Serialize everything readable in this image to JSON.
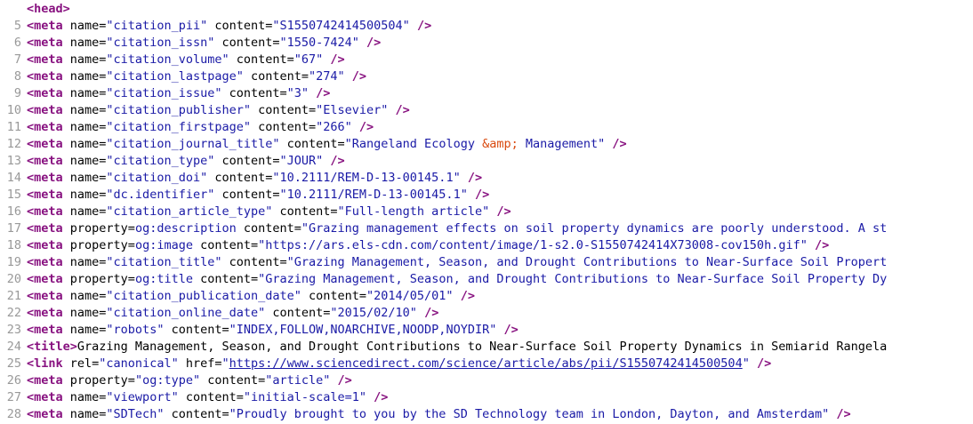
{
  "source_view": {
    "lines": [
      {
        "n": "",
        "tokens": [
          {
            "t": "tag",
            "s": "<head>"
          }
        ]
      },
      {
        "n": "5",
        "tokens": [
          {
            "t": "tag",
            "s": "<meta "
          },
          {
            "t": "attr",
            "s": "name="
          },
          {
            "t": "val",
            "s": "\"citation_pii\""
          },
          {
            "t": "attr",
            "s": " content="
          },
          {
            "t": "val",
            "s": "\"S1550742414500504\""
          },
          {
            "t": "tag",
            "s": " />"
          }
        ]
      },
      {
        "n": "6",
        "tokens": [
          {
            "t": "tag",
            "s": "<meta "
          },
          {
            "t": "attr",
            "s": "name="
          },
          {
            "t": "val",
            "s": "\"citation_issn\""
          },
          {
            "t": "attr",
            "s": " content="
          },
          {
            "t": "val",
            "s": "\"1550-7424\""
          },
          {
            "t": "tag",
            "s": " />"
          }
        ]
      },
      {
        "n": "7",
        "tokens": [
          {
            "t": "tag",
            "s": "<meta "
          },
          {
            "t": "attr",
            "s": "name="
          },
          {
            "t": "val",
            "s": "\"citation_volume\""
          },
          {
            "t": "attr",
            "s": " content="
          },
          {
            "t": "val",
            "s": "\"67\""
          },
          {
            "t": "tag",
            "s": " />"
          }
        ]
      },
      {
        "n": "8",
        "tokens": [
          {
            "t": "tag",
            "s": "<meta "
          },
          {
            "t": "attr",
            "s": "name="
          },
          {
            "t": "val",
            "s": "\"citation_lastpage\""
          },
          {
            "t": "attr",
            "s": " content="
          },
          {
            "t": "val",
            "s": "\"274\""
          },
          {
            "t": "tag",
            "s": " />"
          }
        ]
      },
      {
        "n": "9",
        "tokens": [
          {
            "t": "tag",
            "s": "<meta "
          },
          {
            "t": "attr",
            "s": "name="
          },
          {
            "t": "val",
            "s": "\"citation_issue\""
          },
          {
            "t": "attr",
            "s": " content="
          },
          {
            "t": "val",
            "s": "\"3\""
          },
          {
            "t": "tag",
            "s": " />"
          }
        ]
      },
      {
        "n": "10",
        "tokens": [
          {
            "t": "tag",
            "s": "<meta "
          },
          {
            "t": "attr",
            "s": "name="
          },
          {
            "t": "val",
            "s": "\"citation_publisher\""
          },
          {
            "t": "attr",
            "s": " content="
          },
          {
            "t": "val",
            "s": "\"Elsevier\""
          },
          {
            "t": "tag",
            "s": " />"
          }
        ]
      },
      {
        "n": "11",
        "tokens": [
          {
            "t": "tag",
            "s": "<meta "
          },
          {
            "t": "attr",
            "s": "name="
          },
          {
            "t": "val",
            "s": "\"citation_firstpage\""
          },
          {
            "t": "attr",
            "s": " content="
          },
          {
            "t": "val",
            "s": "\"266\""
          },
          {
            "t": "tag",
            "s": " />"
          }
        ]
      },
      {
        "n": "12",
        "tokens": [
          {
            "t": "tag",
            "s": "<meta "
          },
          {
            "t": "attr",
            "s": "name="
          },
          {
            "t": "val",
            "s": "\"citation_journal_title\""
          },
          {
            "t": "attr",
            "s": " content="
          },
          {
            "t": "val",
            "s": "\"Rangeland Ecology "
          },
          {
            "t": "ent",
            "s": "&amp;"
          },
          {
            "t": "val",
            "s": " Management\""
          },
          {
            "t": "tag",
            "s": " />"
          }
        ]
      },
      {
        "n": "13",
        "tokens": [
          {
            "t": "tag",
            "s": "<meta "
          },
          {
            "t": "attr",
            "s": "name="
          },
          {
            "t": "val",
            "s": "\"citation_type\""
          },
          {
            "t": "attr",
            "s": " content="
          },
          {
            "t": "val",
            "s": "\"JOUR\""
          },
          {
            "t": "tag",
            "s": " />"
          }
        ]
      },
      {
        "n": "14",
        "tokens": [
          {
            "t": "tag",
            "s": "<meta "
          },
          {
            "t": "attr",
            "s": "name="
          },
          {
            "t": "val",
            "s": "\"citation_doi\""
          },
          {
            "t": "attr",
            "s": " content="
          },
          {
            "t": "val",
            "s": "\"10.2111/REM-D-13-00145.1\""
          },
          {
            "t": "tag",
            "s": " />"
          }
        ]
      },
      {
        "n": "15",
        "tokens": [
          {
            "t": "tag",
            "s": "<meta "
          },
          {
            "t": "attr",
            "s": "name="
          },
          {
            "t": "val",
            "s": "\"dc.identifier\""
          },
          {
            "t": "attr",
            "s": " content="
          },
          {
            "t": "val",
            "s": "\"10.2111/REM-D-13-00145.1\""
          },
          {
            "t": "tag",
            "s": " />"
          }
        ]
      },
      {
        "n": "16",
        "tokens": [
          {
            "t": "tag",
            "s": "<meta "
          },
          {
            "t": "attr",
            "s": "name="
          },
          {
            "t": "val",
            "s": "\"citation_article_type\""
          },
          {
            "t": "attr",
            "s": " content="
          },
          {
            "t": "val",
            "s": "\"Full-length article\""
          },
          {
            "t": "tag",
            "s": " />"
          }
        ]
      },
      {
        "n": "17",
        "tokens": [
          {
            "t": "tag",
            "s": "<meta "
          },
          {
            "t": "attr",
            "s": "property="
          },
          {
            "t": "val",
            "s": "og:description"
          },
          {
            "t": "attr",
            "s": " content="
          },
          {
            "t": "val",
            "s": "\"Grazing management effects on soil property dynamics are poorly understood. A st"
          }
        ]
      },
      {
        "n": "18",
        "tokens": [
          {
            "t": "tag",
            "s": "<meta "
          },
          {
            "t": "attr",
            "s": "property="
          },
          {
            "t": "val",
            "s": "og:image"
          },
          {
            "t": "attr",
            "s": " content="
          },
          {
            "t": "val",
            "s": "\"https://ars.els-cdn.com/content/image/1-s2.0-S1550742414X73008-cov150h.gif\""
          },
          {
            "t": "tag",
            "s": " />"
          }
        ]
      },
      {
        "n": "19",
        "tokens": [
          {
            "t": "tag",
            "s": "<meta "
          },
          {
            "t": "attr",
            "s": "name="
          },
          {
            "t": "val",
            "s": "\"citation_title\""
          },
          {
            "t": "attr",
            "s": " content="
          },
          {
            "t": "val",
            "s": "\"Grazing Management, Season, and Drought Contributions to Near-Surface Soil Propert"
          }
        ]
      },
      {
        "n": "20",
        "tokens": [
          {
            "t": "tag",
            "s": "<meta "
          },
          {
            "t": "attr",
            "s": "property="
          },
          {
            "t": "val",
            "s": "og:title"
          },
          {
            "t": "attr",
            "s": " content="
          },
          {
            "t": "val",
            "s": "\"Grazing Management, Season, and Drought Contributions to Near-Surface Soil Property Dy"
          }
        ]
      },
      {
        "n": "21",
        "tokens": [
          {
            "t": "tag",
            "s": "<meta "
          },
          {
            "t": "attr",
            "s": "name="
          },
          {
            "t": "val",
            "s": "\"citation_publication_date\""
          },
          {
            "t": "attr",
            "s": " content="
          },
          {
            "t": "val",
            "s": "\"2014/05/01\""
          },
          {
            "t": "tag",
            "s": " />"
          }
        ]
      },
      {
        "n": "22",
        "tokens": [
          {
            "t": "tag",
            "s": "<meta "
          },
          {
            "t": "attr",
            "s": "name="
          },
          {
            "t": "val",
            "s": "\"citation_online_date\""
          },
          {
            "t": "attr",
            "s": " content="
          },
          {
            "t": "val",
            "s": "\"2015/02/10\""
          },
          {
            "t": "tag",
            "s": " />"
          }
        ]
      },
      {
        "n": "23",
        "tokens": [
          {
            "t": "tag",
            "s": "<meta "
          },
          {
            "t": "attr",
            "s": "name="
          },
          {
            "t": "val",
            "s": "\"robots\""
          },
          {
            "t": "attr",
            "s": " content="
          },
          {
            "t": "val",
            "s": "\"INDEX,FOLLOW,NOARCHIVE,NOODP,NOYDIR\""
          },
          {
            "t": "tag",
            "s": " />"
          }
        ]
      },
      {
        "n": "24",
        "tokens": [
          {
            "t": "tag",
            "s": "<title>"
          },
          {
            "t": "txt",
            "s": "Grazing Management, Season, and Drought Contributions to Near-Surface Soil Property Dynamics in Semiarid Rangela"
          }
        ]
      },
      {
        "n": "25",
        "tokens": [
          {
            "t": "tag",
            "s": "<link "
          },
          {
            "t": "attr",
            "s": "rel="
          },
          {
            "t": "val",
            "s": "\"canonical\""
          },
          {
            "t": "attr",
            "s": " href="
          },
          {
            "t": "val",
            "s": "\""
          },
          {
            "t": "lnk",
            "s": "https://www.sciencedirect.com/science/article/abs/pii/S1550742414500504"
          },
          {
            "t": "val",
            "s": "\""
          },
          {
            "t": "tag",
            "s": " />"
          }
        ]
      },
      {
        "n": "26",
        "tokens": [
          {
            "t": "tag",
            "s": "<meta "
          },
          {
            "t": "attr",
            "s": "property="
          },
          {
            "t": "val",
            "s": "\"og:type\""
          },
          {
            "t": "attr",
            "s": " content="
          },
          {
            "t": "val",
            "s": "\"article\""
          },
          {
            "t": "tag",
            "s": " />"
          }
        ]
      },
      {
        "n": "27",
        "tokens": [
          {
            "t": "tag",
            "s": "<meta "
          },
          {
            "t": "attr",
            "s": "name="
          },
          {
            "t": "val",
            "s": "\"viewport\""
          },
          {
            "t": "attr",
            "s": " content="
          },
          {
            "t": "val",
            "s": "\"initial-scale=1\""
          },
          {
            "t": "tag",
            "s": " />"
          }
        ]
      },
      {
        "n": "28",
        "tokens": [
          {
            "t": "tag",
            "s": "<meta "
          },
          {
            "t": "attr",
            "s": "name="
          },
          {
            "t": "val",
            "s": "\"SDTech\""
          },
          {
            "t": "attr",
            "s": " content="
          },
          {
            "t": "val",
            "s": "\"Proudly brought to you by the SD Technology team in London, Dayton, and Amsterdam\""
          },
          {
            "t": "tag",
            "s": " />"
          }
        ]
      }
    ]
  },
  "colors": {
    "tag": "#881280",
    "value": "#1a1aa6",
    "entity": "#d94a0f",
    "line_number": "#999999"
  }
}
